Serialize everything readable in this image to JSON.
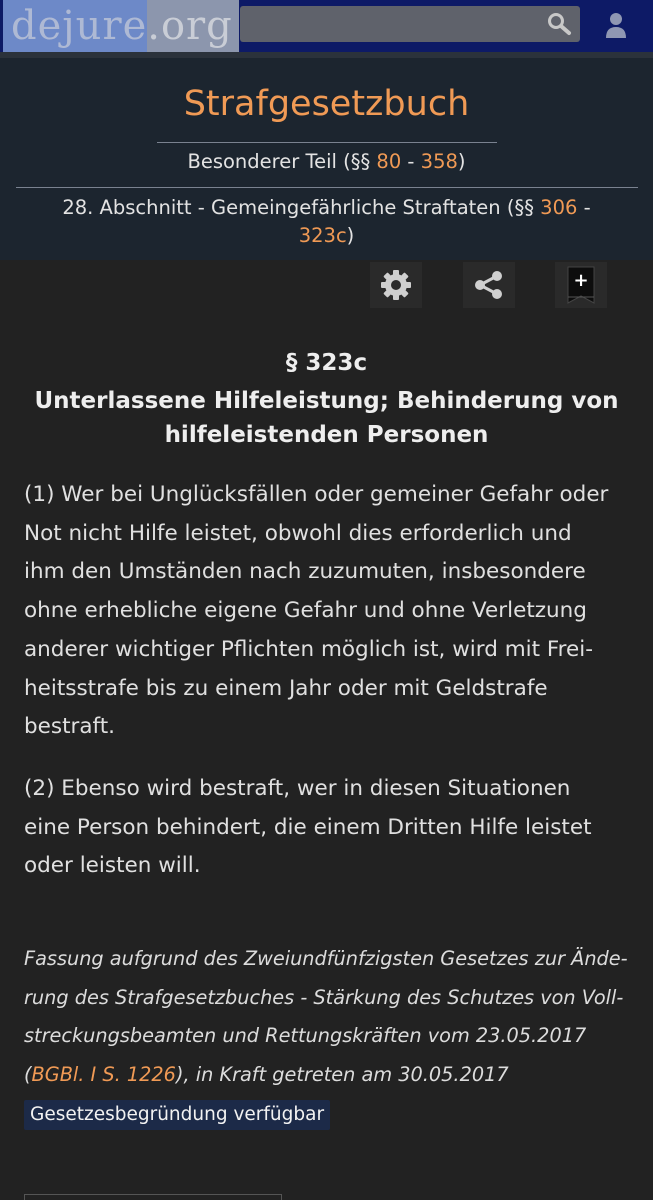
{
  "topbar": {
    "logo_part1": "dejure",
    "logo_part2": ".org",
    "search_placeholder": ""
  },
  "header": {
    "book_title": "Strafgesetzbuch",
    "part": {
      "prefix": "Besonderer Teil (§§ ",
      "from": "80",
      "dash": " - ",
      "to": "358",
      "suffix": ")"
    },
    "section": {
      "prefix": "28. Abschnitt - Gemeingefährliche Straftaten (§§ ",
      "from": "306",
      "dash": " - ",
      "to": "323c",
      "suffix": ")"
    }
  },
  "toolbar": {
    "icons": [
      "gear-icon",
      "share-icon",
      "bookmark-add-icon"
    ],
    "bookmark_symbol": "+"
  },
  "law": {
    "paragraph": "§ 323c",
    "title_line1": "Unterlassene Hilfeleistung; Behinderung von",
    "title_line2": "hilfeleistenden Personen",
    "absatz1": [
      "(1) Wer bei Unglücksfällen oder gemeiner Gefahr oder",
      "Not nicht Hilfe leistet, obwohl dies erforderlich und",
      "ihm den Umständen nach zuzumuten, insbesondere",
      "ohne erhebliche eigene Gefahr und ohne Verletzung",
      "anderer wichtiger Pflichten möglich ist, wird mit Frei-",
      "heitsstrafe bis zu einem Jahr oder mit Geldstrafe",
      "bestraft."
    ],
    "absatz2": [
      "(2) Ebenso wird bestraft, wer in diesen Situationen",
      "eine Person behindert, die einem Dritten Hilfe leistet",
      "oder leisten will."
    ]
  },
  "fassung": {
    "line1": "Fassung aufgrund des Zweiundfünfzigsten Gesetzes zur Ände-",
    "line2": "rung des Strafgesetzbuches - Stärkung des Schutzes von Voll-",
    "line3": "streckungsbeamten und Rettungskräften vom 23.05.2017",
    "line4_open": "(",
    "line4_link": "BGBl. I S. 1226",
    "line4_rest": "), in Kraft getreten am 30.05.2017"
  },
  "begruendung_label": "Gesetzesbegründung verfügbar",
  "colors": {
    "accent": "#f09a55",
    "topbar": "#0d1a66",
    "header_bg": "#1c252f",
    "page_bg": "#222222"
  }
}
